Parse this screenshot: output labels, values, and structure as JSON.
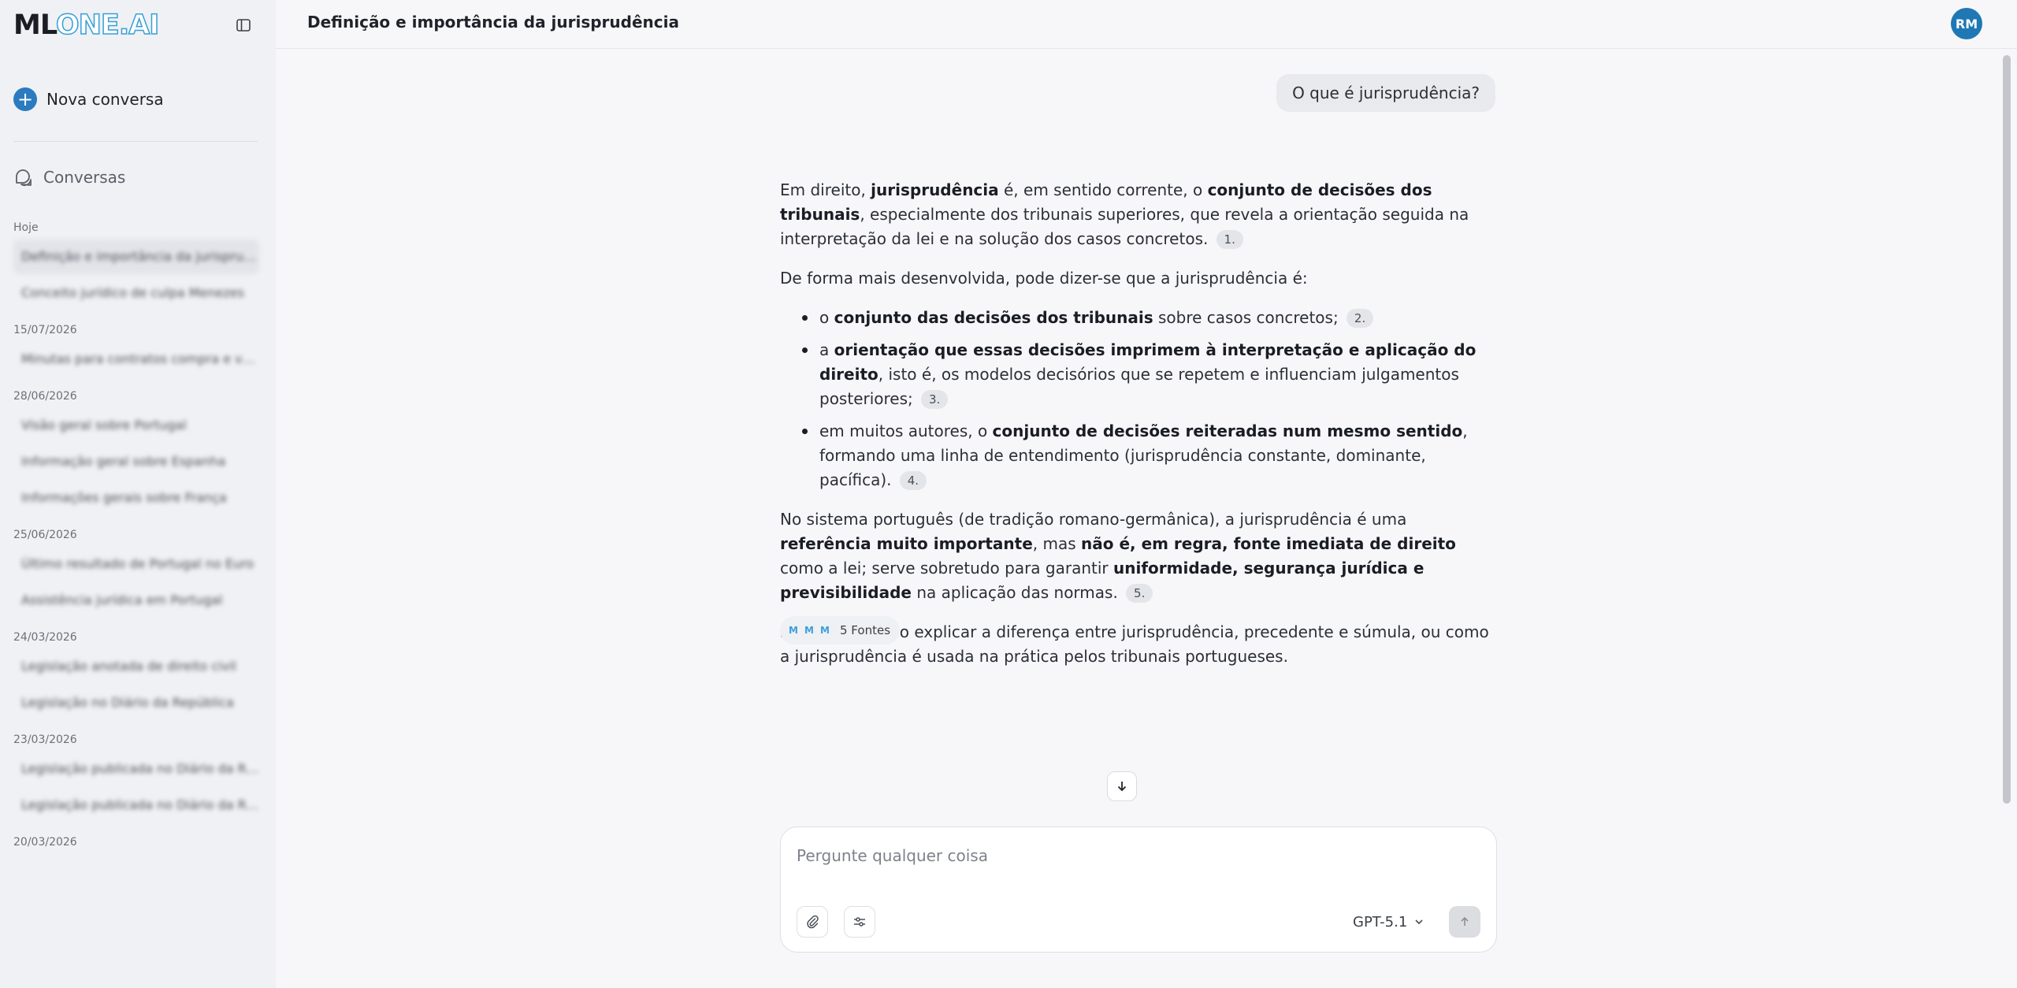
{
  "sidebar": {
    "logo_ml": "ML",
    "logo_one": "ONE.AI",
    "new_chat_label": "Nova conversa",
    "conversations_label": "Conversas",
    "groups": [
      {
        "label": "Hoje",
        "items": [
          "Definição e importância da jurisprudência",
          "Conceito jurídico de culpa Menezes"
        ]
      },
      {
        "label": "15/07/2026",
        "items": [
          "Minutas para contratos compra e venda"
        ]
      },
      {
        "label": "28/06/2026",
        "items": [
          "Visão geral sobre Portugal",
          "Informação geral sobre Espanha",
          "Informações gerais sobre França"
        ]
      },
      {
        "label": "25/06/2026",
        "items": [
          "Último resultado de Portugal no Euro",
          "Assistência jurídica em Portugal"
        ]
      },
      {
        "label": "24/03/2026",
        "items": [
          "Legislação anotada de direito civil",
          "Legislação no Diário da República"
        ]
      },
      {
        "label": "23/03/2026",
        "items": [
          "Legislação publicada no Diário da República",
          "Legislação publicada no Diário da República"
        ]
      },
      {
        "label": "20/03/2026",
        "items": []
      }
    ]
  },
  "header": {
    "title": "Definição e importância da jurisprudência",
    "avatar_initials": "RM"
  },
  "chat": {
    "user_message": "O que é jurisprudência?",
    "answer": {
      "p1": {
        "t1": "Em direito, ",
        "b1": "jurisprudência",
        "t2": " é, em sentido corrente, o ",
        "b2": "conjunto de decisões dos tribunais",
        "t3": ", especialmente dos tribunais superiores, que revela a orientação seguida na interpretação da lei e na solução dos casos concretos.",
        "cite": "1."
      },
      "p2": "De forma mais desenvolvida, pode dizer-se que a jurisprudência é:",
      "bullets": [
        {
          "t1": "o ",
          "b1": "conjunto das decisões dos tribunais",
          "t2": " sobre casos concretos;",
          "cite": "2."
        },
        {
          "t1": "a ",
          "b1": "orientação que essas decisões imprimem à interpretação e aplicação do direito",
          "t2": ", isto é, os modelos decisórios que se repetem e influenciam julgamentos posteriores;",
          "cite": "3."
        },
        {
          "t1": "em muitos autores, o ",
          "b1": "conjunto de decisões reiteradas num mesmo sentido",
          "t2": ", formando uma linha de entendimento (jurisprudência constante, dominante, pacífica).",
          "cite": "4."
        }
      ],
      "p3": {
        "t1": "No sistema português (de tradição romano-germânica), a jurisprudência é uma ",
        "b1": "referência muito importante",
        "t2": ", mas ",
        "b2": "não é, em regra, fonte imediata de direito",
        "t3": " como a lei; serve sobretudo para garantir ",
        "b3": "uniformidade, segurança jurídica e previsibilidade",
        "t4": " na aplicação das normas.",
        "cite": "5."
      },
      "p4": "Se quiser, posso explicar a diferença entre jurisprudência, precedente e súmula, ou como a jurisprudência é usada na prática pelos tribunais portugueses."
    },
    "sources_label": "5 Fontes",
    "source_icon_glyph": "M"
  },
  "composer": {
    "placeholder": "Pergunte qualquer coisa",
    "model": "GPT-5.1"
  },
  "colors": {
    "accent": "#2a7bbf",
    "avatar": "#1f78b4",
    "logo_outline": "#35a0d8"
  }
}
